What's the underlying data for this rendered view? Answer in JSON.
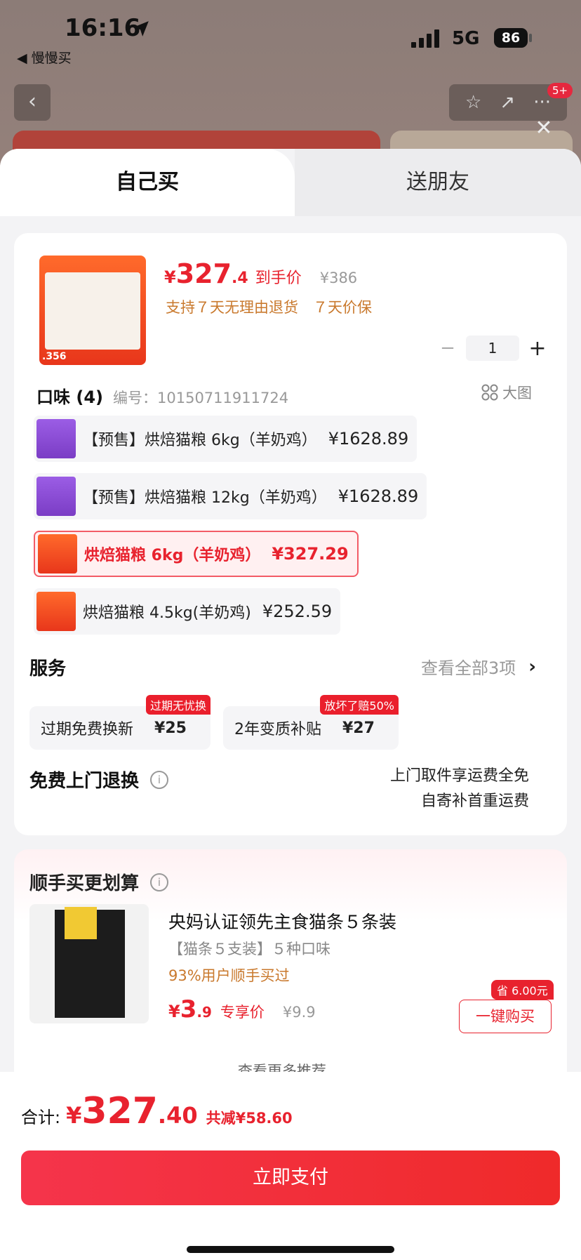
{
  "status": {
    "time": "16:16",
    "back_app": "◀ 慢慢买",
    "network": "5G",
    "battery": "86"
  },
  "background": {
    "badge": "5+"
  },
  "tabs": [
    {
      "label": "自己买"
    },
    {
      "label": "送朋友"
    }
  ],
  "product": {
    "thumb_tag": ".356",
    "currency": "¥",
    "price_int": "327",
    "price_dec": ".4",
    "price_label": "到手价",
    "original_price": "¥386",
    "promise": "支持７天无理由退货　７天价保",
    "quantity": "1"
  },
  "flavor": {
    "title": "口味 (4)",
    "code": "编号：10150711911724",
    "big_pic": "大图",
    "options": [
      {
        "name": "【预售】烘焙猫粮 6kg（羊奶鸡）",
        "price": "¥1628.89",
        "selected": false
      },
      {
        "name": "【预售】烘焙猫粮 12kg（羊奶鸡）",
        "price": "¥1628.89",
        "selected": false
      },
      {
        "name": "烘焙猫粮 6kg（羊奶鸡）",
        "price": "¥327.29",
        "selected": true
      },
      {
        "name": "烘焙猫粮 4.5kg(羊奶鸡)",
        "price": "¥252.59",
        "selected": false
      }
    ]
  },
  "services": {
    "title": "服务",
    "view_all": "查看全部3项",
    "items": [
      {
        "name": "过期免费换新",
        "price": "¥25",
        "tag": "过期无忧换"
      },
      {
        "name": "2年变质补贴",
        "price": "¥27",
        "tag": "放坏了赔50%"
      }
    ]
  },
  "return": {
    "label": "免费上门退换",
    "line1": "上门取件享运费全免",
    "line2": "自寄补首重运费"
  },
  "upsell": {
    "title": "顺手买更划算",
    "product_title": "央妈认证领先主食猫条５条装",
    "subtitle": "【猫条５支装】５种口味",
    "bought": "93%用户顺手买过",
    "currency": "¥",
    "price_int": "3",
    "price_dec": ".9",
    "price_label": "专享价",
    "original_price": "¥9.9",
    "save_tag": "省 6.00元",
    "buy_label": "一键购买",
    "more": "查看更多推荐 ⌄"
  },
  "footer": {
    "total_label": "合计:",
    "currency": "¥",
    "total_int": "327",
    "total_dec": ".40",
    "saved": "共减¥58.60",
    "pay_label": "立即支付"
  }
}
